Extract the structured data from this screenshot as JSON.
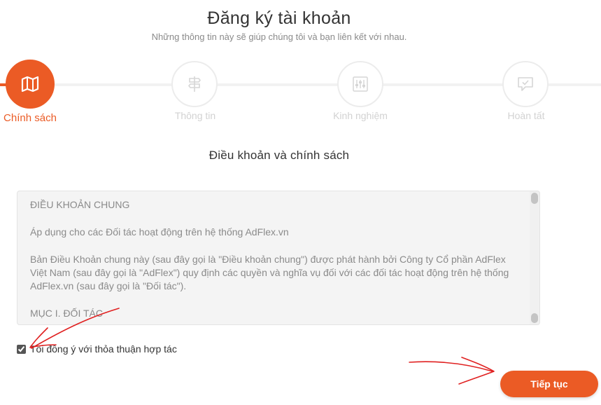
{
  "header": {
    "title": "Đăng ký tài khoản",
    "subtitle": "Những thông tin này sẽ giúp chúng tôi và bạn liên kết với nhau."
  },
  "steps": [
    {
      "label": "Chính sách",
      "icon": "map-icon",
      "active": true
    },
    {
      "label": "Thông tin",
      "icon": "signpost-icon",
      "active": false
    },
    {
      "label": "Kinh nghiệm",
      "icon": "sliders-icon",
      "active": false
    },
    {
      "label": "Hoàn tất",
      "icon": "chat-check-icon",
      "active": false
    }
  ],
  "section_title": "Điều khoản và chính sách",
  "terms": {
    "heading": "ĐIỀU KHOẢN CHUNG",
    "paragraph1": "Áp dụng cho các Đối tác hoạt động trên hệ thống AdFlex.vn",
    "paragraph2": "Bản Điều Khoản chung này (sau đây gọi là \"Điều khoản chung\") được phát hành bởi Công ty Cổ phần AdFlex Việt Nam (sau đây gọi là \"AdFlex\") quy định các quyền và nghĩa vụ đối với các đối tác hoạt động trên hệ thống AdFlex.vn (sau đây gọi là \"Đối tác\").",
    "paragraph3": "MỤC I. ĐỐI TÁC"
  },
  "agree": {
    "label": "Tôi đồng ý với thỏa thuận hợp tác",
    "checked": true
  },
  "next_button": "Tiếp tục",
  "colors": {
    "accent": "#eb5b25",
    "annotation": "#e02020"
  }
}
